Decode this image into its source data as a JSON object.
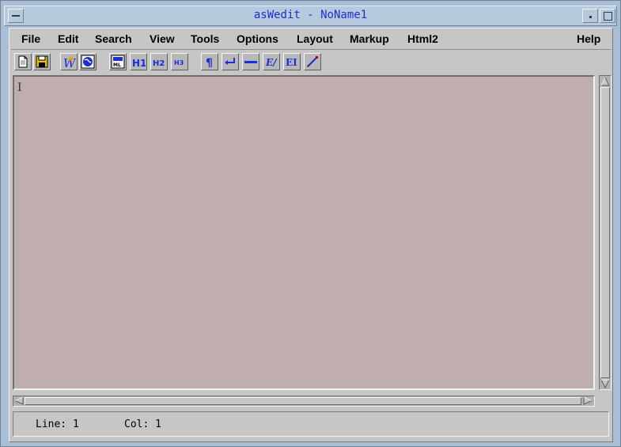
{
  "window": {
    "title": "asWedit - NoName1"
  },
  "menubar": {
    "file": "File",
    "edit": "Edit",
    "search": "Search",
    "view": "View",
    "tools": "Tools",
    "options": "Options",
    "layout": "Layout",
    "markup": "Markup",
    "html2": "Html2",
    "help": "Help"
  },
  "toolbar": {
    "icons": [
      "new-document-icon",
      "save-disk-icon",
      "wizard-icon",
      "preview-globe-icon",
      "html-tag-icon",
      "h1-heading-icon",
      "h2-heading-icon",
      "h3-heading-icon",
      "paragraph-icon",
      "line-break-icon",
      "horizontal-rule-icon",
      "emphasis-icon",
      "strong-icon",
      "link-pen-icon"
    ],
    "h1": "H1",
    "h2": "H2",
    "h3": "H3",
    "emphasis": "E/",
    "strong": "EI"
  },
  "status": {
    "line": "Line: 1",
    "col": "Col: 1"
  },
  "colors": {
    "editor_background": "#c0aeae",
    "title_text": "#1c2fd0",
    "window_frame": "#a9bdd4",
    "panel": "#c6c6c6"
  }
}
